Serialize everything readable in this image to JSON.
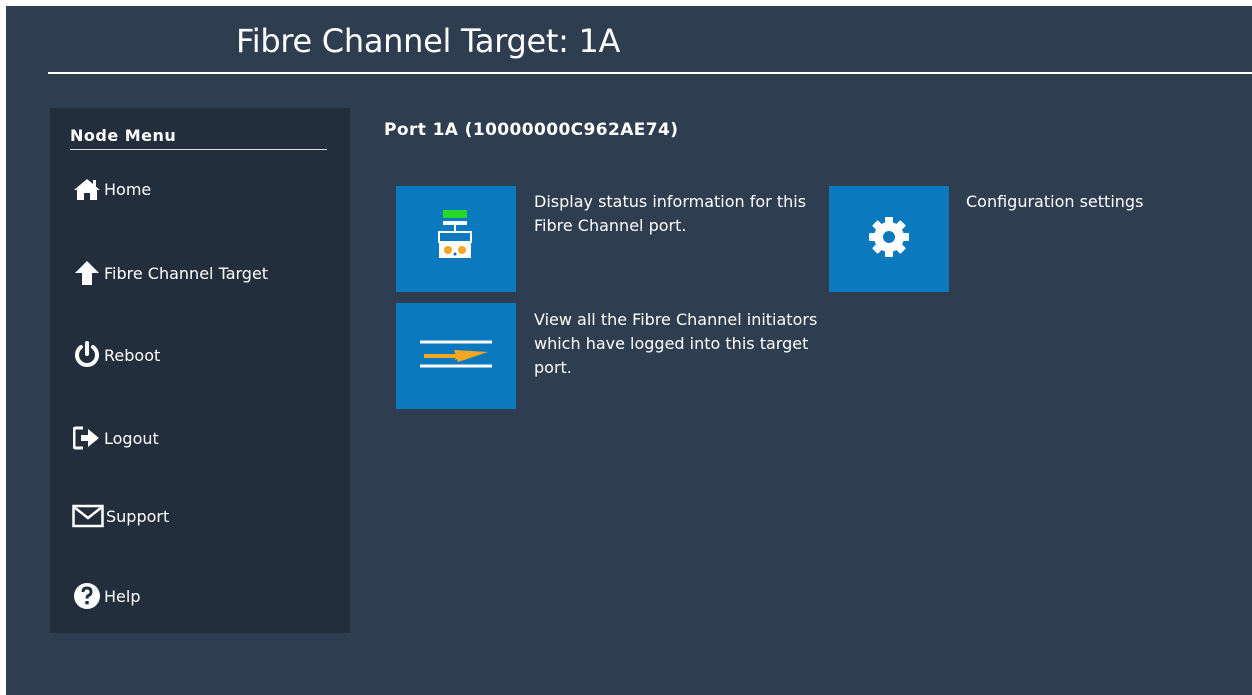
{
  "header": {
    "title": "Fibre Channel Target: 1A"
  },
  "sidebar": {
    "heading": "Node Menu",
    "items": [
      {
        "label": "Home",
        "icon": "home-icon"
      },
      {
        "label": "Fibre Channel Target",
        "icon": "arrow-up-icon"
      },
      {
        "label": "Reboot",
        "icon": "power-icon"
      },
      {
        "label": "Logout",
        "icon": "logout-icon"
      },
      {
        "label": "Support",
        "icon": "envelope-icon"
      },
      {
        "label": "Help",
        "icon": "question-icon"
      }
    ]
  },
  "main": {
    "port_title": "Port 1A (10000000C962AE74)",
    "tiles": [
      {
        "icon": "port-status-icon",
        "description": "Display status information for this Fibre Channel port."
      },
      {
        "icon": "gear-icon",
        "description": "Configuration settings"
      },
      {
        "icon": "initiators-icon",
        "description": "View all the Fibre Channel initiators which have logged into this target port."
      }
    ]
  },
  "colors": {
    "page_bg": "#2e3d4f",
    "sidebar_bg": "#222e3c",
    "tile_bg": "#0a79bd",
    "accent_orange": "#f5a623",
    "accent_green": "#26d926"
  }
}
